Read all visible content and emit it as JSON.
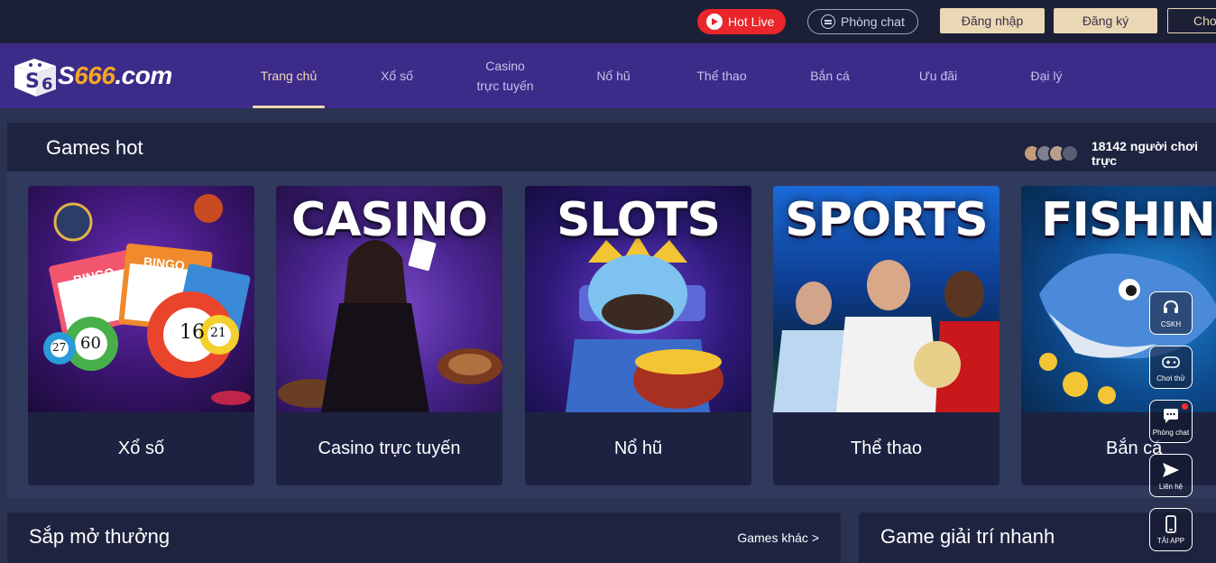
{
  "topbar": {
    "hot_live": "Hot Live",
    "phong_chat": "Phòng chat",
    "login": "Đăng nhập",
    "register": "Đăng ký",
    "choi": "Chơ"
  },
  "logo": {
    "prefix": "S",
    "number": "666",
    "suffix": ".com"
  },
  "nav": {
    "items": [
      {
        "label": "Trang chủ"
      },
      {
        "label": "Xổ số"
      },
      {
        "label": "Casino",
        "label2": "trực tuyến"
      },
      {
        "label": "Nổ hũ"
      },
      {
        "label": "Thể thao"
      },
      {
        "label": "Bắn cá"
      },
      {
        "label": "Ưu đãi"
      },
      {
        "label": "Đại lý"
      }
    ]
  },
  "games_hot": {
    "title": "Games hot",
    "players": "18142 người chơi trực",
    "cards": [
      {
        "label": "Xổ số",
        "image_text": ""
      },
      {
        "label": "Casino trực tuyến",
        "image_text": "CASINO"
      },
      {
        "label": "Nổ hũ",
        "image_text": "SLOTS"
      },
      {
        "label": "Thể thao",
        "image_text": "SPORTS"
      },
      {
        "label": "Bắn cá",
        "image_text": "FISHING"
      }
    ]
  },
  "bingo": {
    "ball1": "60",
    "ball2": "16",
    "ball3": "21",
    "ball4": "27",
    "card_label": "BINGO"
  },
  "panels": {
    "left_title": "Sắp mở thưởng",
    "left_link": "Games khác >",
    "right_title": "Game giải trí nhanh"
  },
  "float_buttons": [
    {
      "label": "CSKH",
      "icon": "headset-icon"
    },
    {
      "label": "Chơi thử",
      "icon": "gamepad-icon"
    },
    {
      "label": "Phòng chat",
      "icon": "chat-bubble-icon"
    },
    {
      "label": "Liên hệ",
      "icon": "send-icon"
    },
    {
      "label": "TẢI APP",
      "icon": "phone-icon"
    }
  ],
  "colors": {
    "accent_gold": "#ead7b4",
    "nav_purple": "#3d2b8a",
    "hot_live_red": "#e8262b",
    "page_bg": "#2b3352"
  }
}
